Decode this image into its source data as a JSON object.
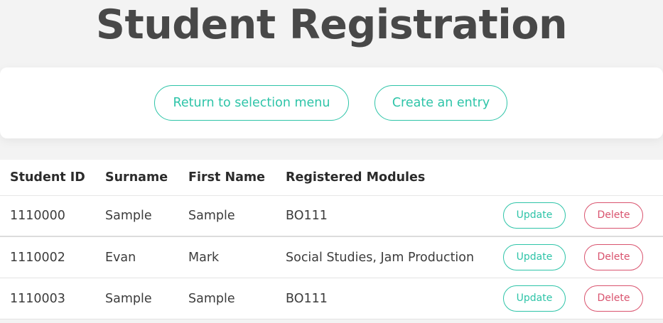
{
  "page": {
    "title": "Student Registration"
  },
  "actions": {
    "return_label": "Return to selection menu",
    "create_label": "Create an entry"
  },
  "table": {
    "headers": [
      "Student ID",
      "Surname",
      "First Name",
      "Registered Modules"
    ],
    "rows": [
      {
        "student_id": "1110000",
        "surname": "Sample",
        "first_name": "Sample",
        "modules": "BO111",
        "update_label": "Update",
        "delete_label": "Delete"
      },
      {
        "student_id": "1110002",
        "surname": "Evan",
        "first_name": "Mark",
        "modules": "Social Studies, Jam Production",
        "update_label": "Update",
        "delete_label": "Delete"
      },
      {
        "student_id": "1110003",
        "surname": "Sample",
        "first_name": "Sample",
        "modules": "BO111",
        "update_label": "Update",
        "delete_label": "Delete"
      }
    ]
  },
  "colors": {
    "accent": "#2ec4a8",
    "danger": "#d9536e",
    "title_text": "#484848",
    "background": "#f3f3f3"
  }
}
